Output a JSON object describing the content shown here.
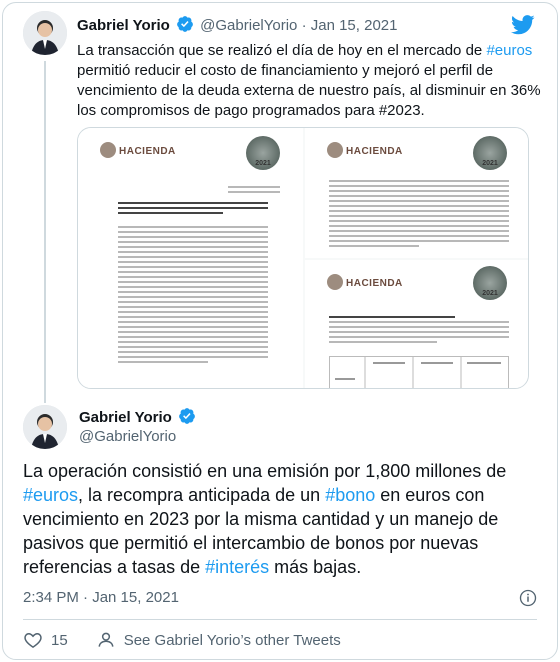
{
  "parent_tweet": {
    "author_name": "Gabriel Yorio",
    "handle": "@GabrielYorio",
    "separator": "·",
    "date": "Jan 15, 2021",
    "text_parts": [
      {
        "t": "La transacción que se realizó el día de hoy en el mercado de ",
        "tag": false
      },
      {
        "t": "#euros",
        "tag": true
      },
      {
        "t": " permitió reducir el costo de financiamiento y mejoró el perfil de vencimiento de la deuda externa de nuestro país, al disminuir en 36% los compromisos de pago programados para #2023.",
        "tag": false
      }
    ],
    "media": {
      "doc_brand": "HACIENDA",
      "seal_year": "2021"
    }
  },
  "main_tweet": {
    "author_name": "Gabriel Yorio",
    "handle": "@GabrielYorio",
    "text_parts": [
      {
        "t": "La operación consistió en una emisión por 1,800 millones de ",
        "tag": false
      },
      {
        "t": "#euros",
        "tag": true
      },
      {
        "t": ", la recompra anticipada de un ",
        "tag": false
      },
      {
        "t": "#bono",
        "tag": true
      },
      {
        "t": " en euros con vencimiento en 2023 por la misma cantidad y un  manejo de pasivos que permitió el intercambio de bonos por nuevas referencias a tasas de ",
        "tag": false
      },
      {
        "t": "#interés",
        "tag": true
      },
      {
        "t": " más bajas.",
        "tag": false
      }
    ],
    "timestamp": "2:34 PM · Jan 15, 2021",
    "like_count": "15",
    "see_other_label": "See Gabriel Yorio’s other Tweets"
  },
  "colors": {
    "accent": "#1d9bf0",
    "secondary_text": "#536471",
    "border": "#cfd9de",
    "like_icon": "#536471"
  },
  "icons": {
    "verified": "verified-badge-icon",
    "brand": "twitter-bird-icon",
    "info": "info-circle-icon",
    "like": "heart-icon",
    "profile": "person-icon"
  }
}
